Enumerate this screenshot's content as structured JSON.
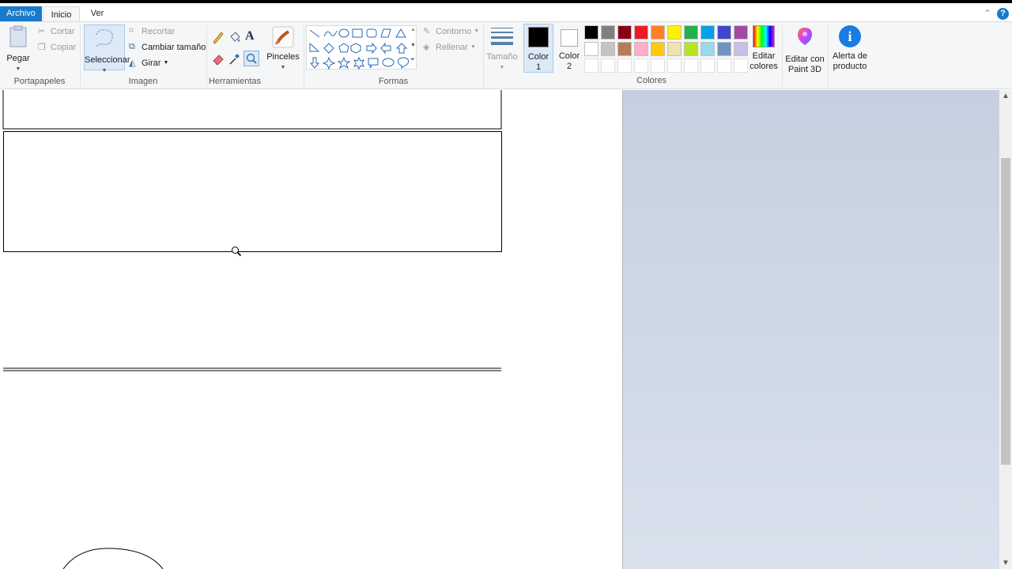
{
  "tabs": {
    "file": "Archivo",
    "home": "Inicio",
    "view": "Ver"
  },
  "clipboard": {
    "paste": "Pegar",
    "cut": "Cortar",
    "copy": "Copiar",
    "group": "Portapapeles"
  },
  "image": {
    "select": "Seleccionar",
    "crop": "Recortar",
    "resize": "Cambiar tamaño",
    "rotate": "Girar",
    "group": "Imagen"
  },
  "tools": {
    "group": "Herramientas",
    "brushes": "Pinceles"
  },
  "shapes": {
    "outline": "Contorno",
    "fill": "Rellenar",
    "group": "Formas"
  },
  "size": {
    "label": "Tamaño"
  },
  "colors": {
    "color1": "Color",
    "color1_num": "1",
    "color2": "Color",
    "color2_num": "2",
    "edit": "Editar",
    "edit2": "colores",
    "group": "Colores",
    "active_color1": "#000000",
    "active_color2": "#ffffff",
    "palette_row1": [
      "#000000",
      "#7f7f7f",
      "#880015",
      "#ed1c24",
      "#ff7f27",
      "#fff200",
      "#22b14c",
      "#00a2e8",
      "#3f48cc",
      "#a349a4"
    ],
    "palette_row2": [
      "#ffffff",
      "#c3c3c3",
      "#b97a57",
      "#ffaec9",
      "#ffc90e",
      "#efe4b0",
      "#b5e61d",
      "#99d9ea",
      "#7092be",
      "#c8bfe7"
    ]
  },
  "paint3d": {
    "line1": "Editar con",
    "line2": "Paint 3D"
  },
  "alert": {
    "line1": "Alerta de",
    "line2": "producto"
  }
}
